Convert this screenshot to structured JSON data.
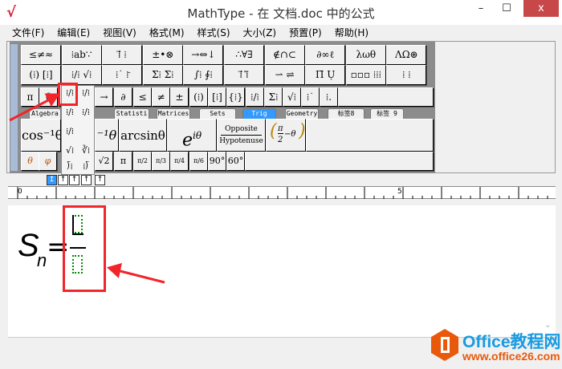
{
  "window": {
    "title": "MathType - 在 文档.doc 中的公式",
    "minimize": "–",
    "maximize": "☐",
    "close": "x"
  },
  "menu": [
    "文件(F)",
    "编辑(E)",
    "视图(V)",
    "格式(M)",
    "样式(S)",
    "大小(Z)",
    "预置(P)",
    "帮助(H)"
  ],
  "palette_row1": [
    "≤≠≈",
    "⁞ab∵",
    "⁞⃗ ⁞",
    "±•⊗",
    "→⇔↓",
    "∴∀∃",
    "∉∩⊂",
    "∂∞ℓ",
    "λωθ",
    "ΛΩ⊛"
  ],
  "palette_row2": [
    "(⁞) [⁞]",
    "⁞/⁞ √⁞",
    "⁞˙ ⁞̄",
    "Σ⁞ Σ⁞",
    "∫⁞ ∮⁞",
    "⁞⃗ ⁞⃖",
    "⇀ ⇌",
    "Π̄ Ụ",
    "▫▫▫ ⁞⁞⁞",
    "⁞ ⁞"
  ],
  "small_row": [
    "π",
    "θ",
    "⁞/⁞",
    "→",
    "∂",
    "≤",
    "≠",
    "±",
    "(⁞)",
    "[⁞]",
    "{⁞}",
    "⁞/⁞",
    "Σ⁞",
    "√⁞",
    "⁞˙",
    "⁞."
  ],
  "tabs": [
    "Algebra",
    "Statisti",
    "Matrices",
    "Sets",
    "Trig",
    "Geometry",
    "标签8",
    "标签 9"
  ],
  "active_tab": "Trig",
  "trig_row": [
    "cos⁻¹θ",
    "⁻¹θ",
    "arcsinθ",
    "e",
    "iθ",
    "Opposite",
    "Hypotenuse",
    "π",
    "2",
    "−θ"
  ],
  "trig_small": [
    "θ",
    "φ",
    "√2",
    "π",
    "π/2",
    "π/3",
    "π/4",
    "π/6",
    "90°",
    "60°"
  ],
  "popup_items": [
    "⁞/⁞",
    "⁞/⁞",
    "⁞/⁞",
    "⁞/⁞",
    "⁞/⁞",
    "√⁞",
    "∛⁞",
    "⟌⁞",
    "⁞⟌"
  ],
  "nudge": [
    "↥",
    "↑",
    "↑",
    "↑",
    "↑"
  ],
  "ruler": {
    "start": "0",
    "mark": "5"
  },
  "equation": {
    "lhs": "S",
    "sub": "n",
    "eq": "="
  },
  "watermark": {
    "brand": "Office教程网",
    "url": "www.office26.com"
  },
  "colors": {
    "highlight": "#f0262a",
    "accent": "#3399ff"
  }
}
